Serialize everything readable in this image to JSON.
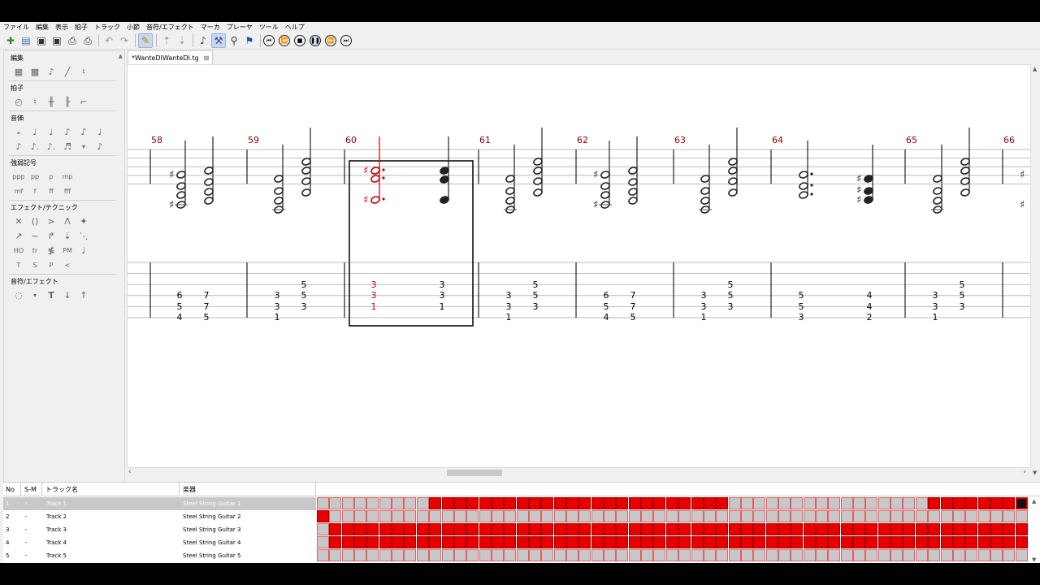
{
  "menu": [
    "ファイル",
    "編集",
    "表示",
    "拍子",
    "トラック",
    "小節",
    "音符/エフェクト",
    "マーカ",
    "プレーヤ",
    "ツール",
    "ヘルプ"
  ],
  "tab": {
    "title": "*WanteDIWanteDI.tg"
  },
  "panel": {
    "groups": [
      {
        "title": "編集",
        "icons": [
          "▦",
          "▩",
          "♪",
          "╱",
          "♮"
        ]
      },
      {
        "title": "拍子",
        "icons": [
          "◴",
          "♮",
          "╫",
          "╟",
          "⌐"
        ]
      },
      {
        "title": "音価",
        "icons": [
          "𝅝",
          "♩",
          "♩",
          "♪",
          "♪",
          "♩",
          "♪",
          "♪.",
          "♬",
          "♪"
        ]
      },
      {
        "title": "強弱記号",
        "icons": [
          "ppp",
          "pp",
          "p",
          "mp",
          "mf",
          "f",
          "ff",
          "fff"
        ]
      },
      {
        "title": "エフェクト/テクニック",
        "icons": [
          "✕",
          "()",
          ">",
          "Λ",
          "✦",
          "↗",
          "∼",
          "↱",
          "⇣",
          "⋱",
          "HO",
          "tr",
          "≸",
          "PM",
          "♩",
          "T",
          "S",
          "P",
          "<"
        ]
      },
      {
        "title": "音符/エフェクト",
        "icons": [
          "◌",
          "T",
          "↓",
          "↑"
        ]
      }
    ]
  },
  "score": {
    "measures": [
      "58",
      "59",
      "60",
      "61",
      "62",
      "63",
      "64",
      "65",
      "66"
    ]
  },
  "tracks": {
    "headers": {
      "no": "No",
      "sm": "S-M",
      "name": "トラック名",
      "instrument": "楽器"
    },
    "rows": [
      {
        "no": "1",
        "sm": "-",
        "name": "Track 1",
        "instrument": "Steel String Guitar 1"
      },
      {
        "no": "2",
        "sm": "-",
        "name": "Track 2",
        "instrument": "Steel String Guitar 2"
      },
      {
        "no": "3",
        "sm": "-",
        "name": "Track 3",
        "instrument": "Steel String Guitar 3"
      },
      {
        "no": "4",
        "sm": "-",
        "name": "Track 4",
        "instrument": "Steel String Guitar 4"
      },
      {
        "no": "5",
        "sm": "-",
        "name": "Track 5",
        "instrument": "Steel String Guitar 5"
      }
    ]
  },
  "colors": {
    "accent": "#e80000",
    "measure_number": "#8b0000",
    "selection": "#c00000"
  }
}
